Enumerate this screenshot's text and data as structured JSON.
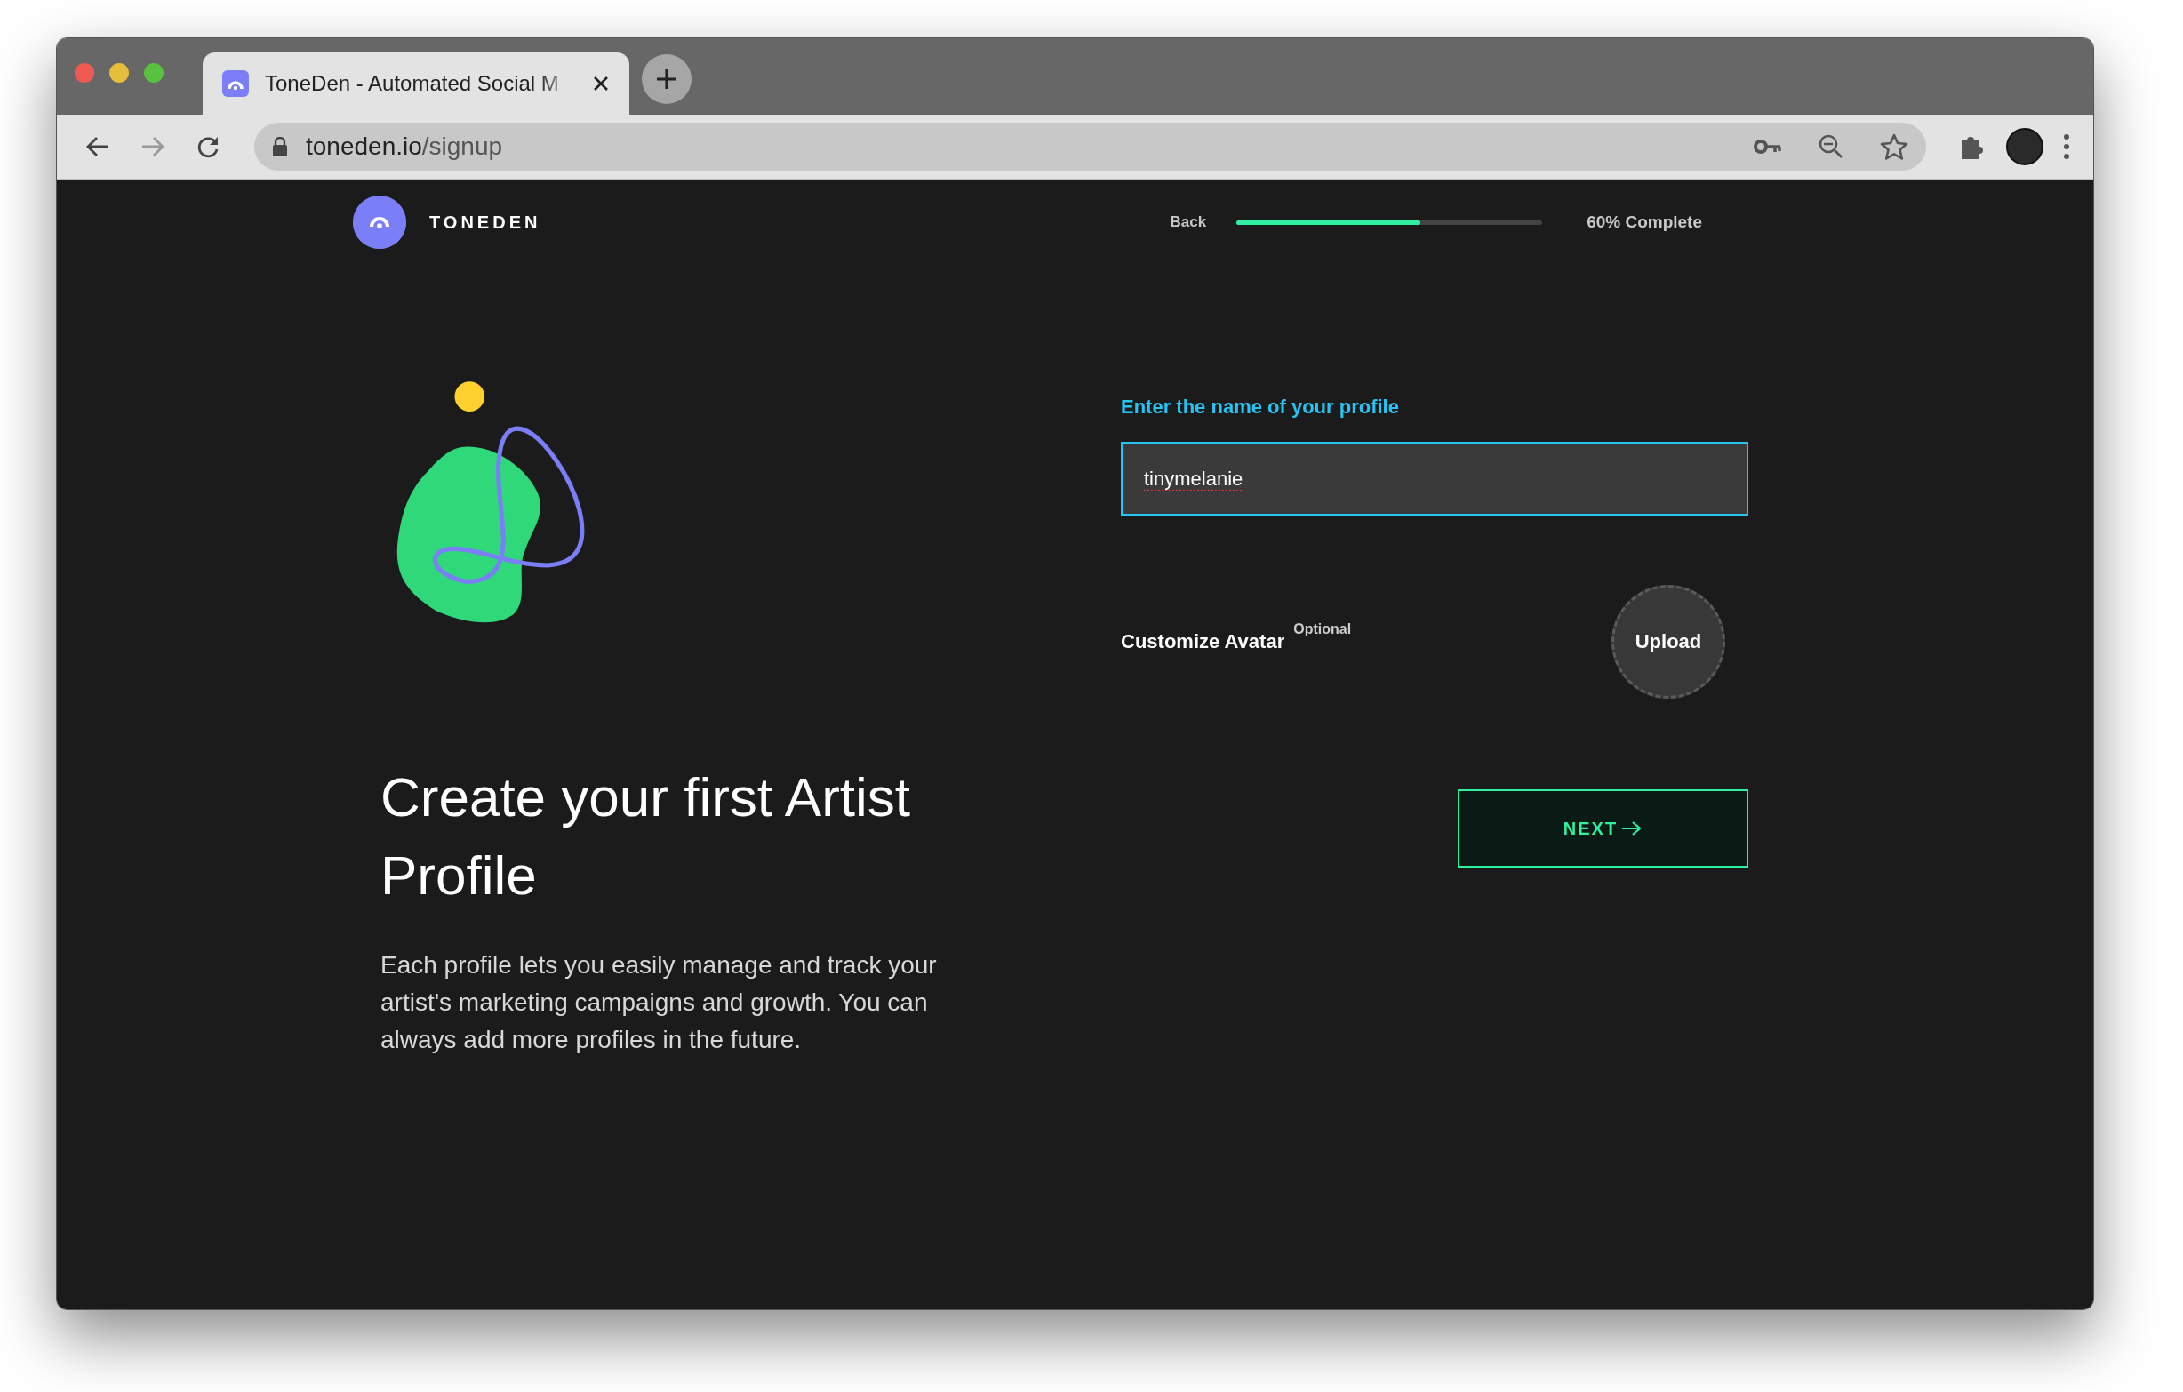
{
  "browser": {
    "tab": {
      "title": "ToneDen - Automated Social M"
    },
    "address": {
      "host": "toneden.io",
      "path": "/signup"
    }
  },
  "header": {
    "brand": "TONEDEN",
    "back": "Back",
    "progress": {
      "level": 0.6,
      "reading": "60% Complete"
    }
  },
  "hero": {
    "title": "Create your first Artist Profile",
    "body": "Each profile lets you easily manage and track your artist's marketing campaigns and growth. You can always add more profiles in the future."
  },
  "form": {
    "name_label": "Enter the name of your profile",
    "name_field": {
      "value": "tinymelanie",
      "focused": true
    },
    "avatar_label": "Customize Avatar",
    "avatar_note": "Optional",
    "upload": "Upload",
    "next": "NEXT"
  }
}
